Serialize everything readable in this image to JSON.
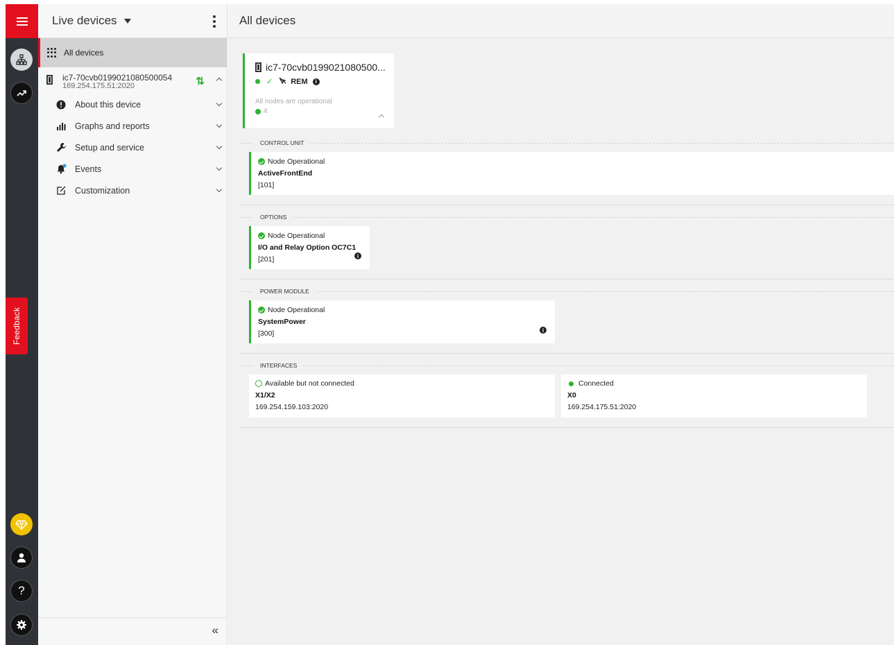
{
  "rail": {
    "menu_icon": "hamburger-icon",
    "feedback_label": "Feedback",
    "items": [
      "network-icon",
      "trend-icon",
      "premium-icon",
      "user-icon",
      "help-icon",
      "settings-icon"
    ]
  },
  "side": {
    "title": "Live devices",
    "all_devices_label": "All devices",
    "device": {
      "name": "ic7-70cvb0199021080500054",
      "ip": "169.254.175.51:2020"
    },
    "nav": [
      {
        "label": "About this device",
        "icon": "info-icon"
      },
      {
        "label": "Graphs and reports",
        "icon": "bar-chart-icon"
      },
      {
        "label": "Setup and service",
        "icon": "wrench-icon"
      },
      {
        "label": "Events",
        "icon": "bell-icon"
      },
      {
        "label": "Customization",
        "icon": "edit-icon"
      }
    ],
    "collapse": "«"
  },
  "main": {
    "title": "All devices",
    "summary": {
      "name": "ic7-70cvb0199021080500...",
      "mode": "REM",
      "description": "All nodes are operational",
      "count": "4"
    },
    "sections": {
      "control_unit": {
        "title": "CONTROL UNIT",
        "status": "Node Operational",
        "name": "ActiveFrontEnd",
        "id": "[101]"
      },
      "options": {
        "title": "OPTIONS",
        "status": "Node Operational",
        "name": "I/O and Relay Option OC7C1",
        "id": "[201]"
      },
      "power_module": {
        "title": "POWER MODULE",
        "status": "Node Operational",
        "name": "SystemPower",
        "id": "[300]"
      },
      "interfaces": {
        "title": "INTERFACES",
        "items": [
          {
            "status": "Available but not connected",
            "name": "X1/X2",
            "address": "169.254.159.103:2020"
          },
          {
            "status": "Connected",
            "name": "X0",
            "address": "169.254.175.51:2020"
          }
        ]
      }
    }
  },
  "colors": {
    "brand_red": "#e3101f",
    "ok_green": "#2eb22e",
    "rail_dark": "#2f3338",
    "premium_yellow": "#f3c200"
  }
}
